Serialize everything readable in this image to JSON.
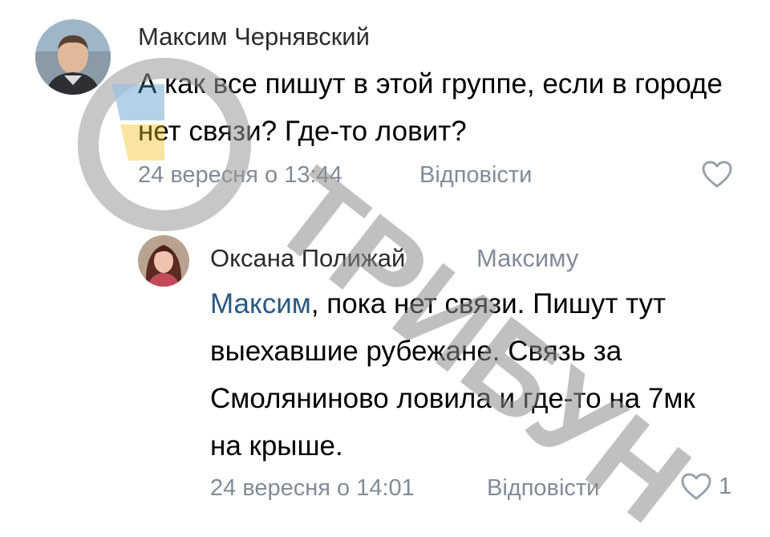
{
  "comments": [
    {
      "author": "Максим Чернявский",
      "text": "А как все пишут в этой группе, если в городе нет связи? Где-то ловит?",
      "date": "24 вересня о 13:44",
      "reply_label": "Відповісти",
      "likes": ""
    },
    {
      "author": "Оксана Полижай",
      "reply_to": "Максиму",
      "mention": "Максим",
      "text": ", пока нет связи. Пишут тут выехавшие рубежане. Связь за Смоляниново ловила и где-то на 7мк на крыше.",
      "date": "24 вересня о 14:01",
      "reply_label": "Відповісти",
      "likes": "1"
    }
  ],
  "watermark": {
    "text": "ТРИБУН",
    "color": "#d9d9d9",
    "accent_blue": "#4a90c8",
    "accent_yellow": "#f2c21b"
  },
  "colors": {
    "meta": "#818c99",
    "mention": "#2a5885"
  },
  "icons": {
    "like": "heart-outline-icon"
  }
}
